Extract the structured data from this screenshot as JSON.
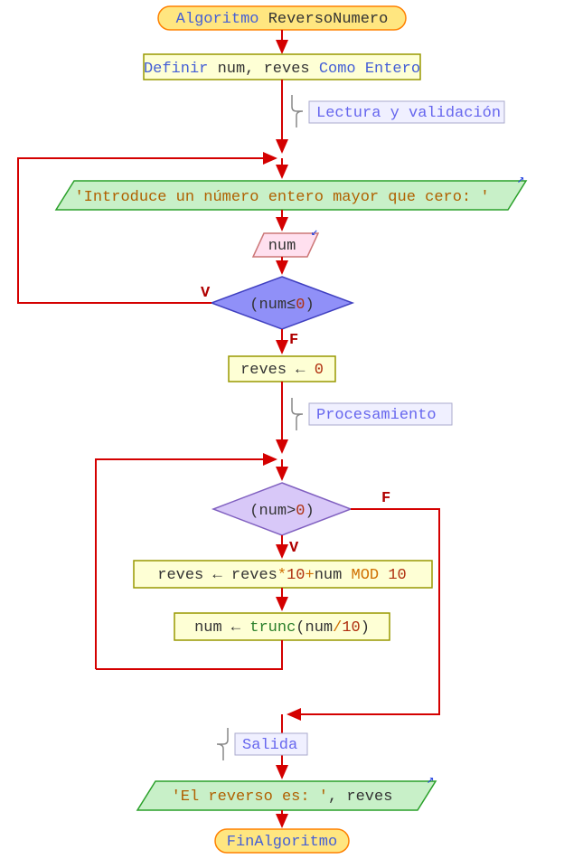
{
  "colors": {
    "arrow": "#d40000",
    "terminal_fill": "#ffe680",
    "terminal_stroke": "#ff8000",
    "process_fill": "#feffd5",
    "process_stroke": "#999900",
    "io_out_fill": "#c8f0c8",
    "io_out_stroke": "#2aa02a",
    "io_in_fill": "#ffe0ef",
    "io_in_stroke": "#c77",
    "decision1_fill": "#9090f8",
    "decision1_stroke": "#4040c0",
    "decision2_fill": "#d8c8f8",
    "decision2_stroke": "#8060c0",
    "comment_fill": "#f0f0ff",
    "comment_stroke": "#aaaacc",
    "comment_text": "#6666ee",
    "bracket": "#888888"
  },
  "start": {
    "kw": "Algoritmo",
    "name": "ReversoNumero"
  },
  "define": {
    "kw1": "Definir",
    "vars": "num, reves",
    "kw2": "Como",
    "type": "Entero"
  },
  "comment1": "Lectura y validación",
  "prompt": "'Introduce un número entero mayor que cero: '",
  "input": "num",
  "cond1": {
    "open": "(",
    "var": "num",
    "op": "≤",
    "val": "0",
    "close": ")"
  },
  "init": {
    "lhs": "reves",
    "arrow": "←",
    "rhs": "0"
  },
  "comment2": "Procesamiento",
  "cond2": {
    "open": "(",
    "var": "num",
    "op": ">",
    "val": "0",
    "close": ")"
  },
  "assign1": {
    "lhs": "reves",
    "arrow": "←",
    "rhs_a": "reves",
    "star": "*",
    "ten": "10",
    "plus": "+",
    "num": "num",
    "mod": "MOD",
    "ten2": "10"
  },
  "assign2": {
    "lhs": "num",
    "arrow": "←",
    "fn": "trunc",
    "open": "(",
    "arg_a": "num",
    "slash": "/",
    "arg_b": "10",
    "close": ")"
  },
  "comment3": "Salida",
  "output": {
    "lit": "'El reverso es: '",
    "comma": ",",
    "var": "reves"
  },
  "end": "FinAlgoritmo",
  "labels": {
    "V": "V",
    "F": "F"
  }
}
